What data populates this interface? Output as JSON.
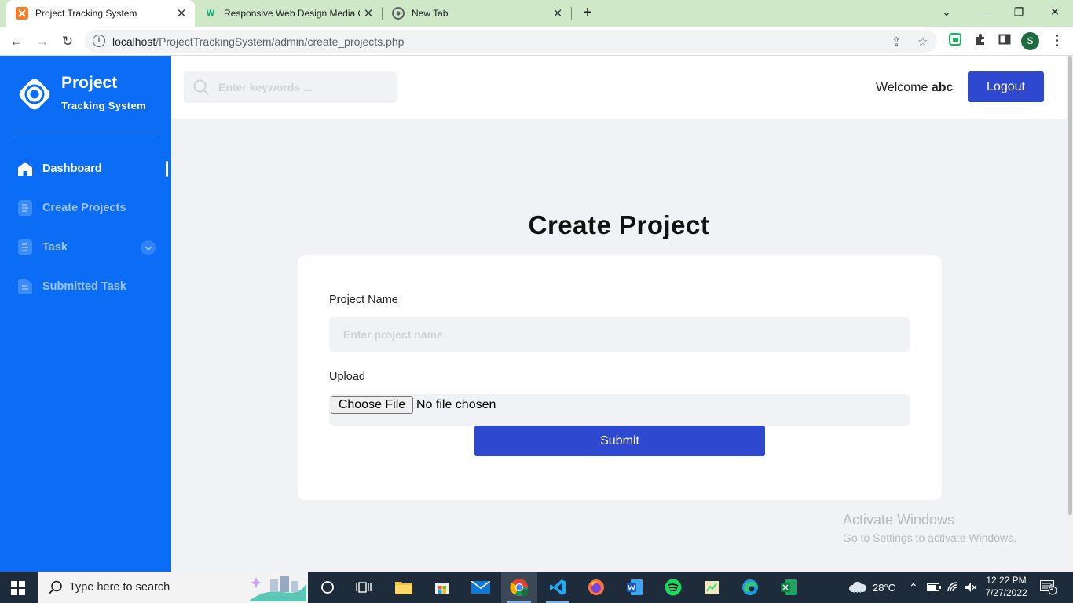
{
  "browser": {
    "tabs": [
      {
        "title": "Project Tracking System",
        "icon": "xampp-icon",
        "active": true
      },
      {
        "title": "Responsive Web Design Media Q",
        "icon": "w3-icon",
        "active": false
      },
      {
        "title": "New Tab",
        "icon": "chrome-icon",
        "active": false
      }
    ],
    "url_host": "localhost",
    "url_path": "/ProjectTrackingSystem/admin/create_projects.php",
    "profile_initial": "S"
  },
  "sidebar": {
    "brand_title": "Project",
    "brand_subtitle": "Tracking System",
    "items": [
      {
        "label": "Dashboard",
        "icon": "home-icon",
        "active": true
      },
      {
        "label": "Create Projects",
        "icon": "document-icon",
        "active": false
      },
      {
        "label": "Task",
        "icon": "document-icon",
        "active": false,
        "has_submenu": true
      },
      {
        "label": "Submitted Task",
        "icon": "file-icon",
        "active": false
      }
    ]
  },
  "header": {
    "search_placeholder": "Enter keywords ...",
    "welcome_text": "Welcome",
    "username": "abc",
    "logout_label": "Logout"
  },
  "form": {
    "title": "Create Project",
    "project_name_label": "Project Name",
    "project_name_placeholder": "Enter project name",
    "project_name_value": "",
    "upload_label": "Upload",
    "choose_file_label": "Choose File",
    "file_status": "No file chosen",
    "submit_label": "Submit"
  },
  "watermark": {
    "line1": "Activate Windows",
    "line2": "Go to Settings to activate Windows."
  },
  "taskbar": {
    "search_text": "Type here to search",
    "weather": "28°C",
    "time": "12:22 PM",
    "date": "7/27/2022",
    "notification_count": "1"
  },
  "colors": {
    "sidebar": "#0b6cf6",
    "primary_button": "#2e49d0",
    "page_background": "#f1f2f6",
    "tab_strip": "#cfe8c8"
  }
}
